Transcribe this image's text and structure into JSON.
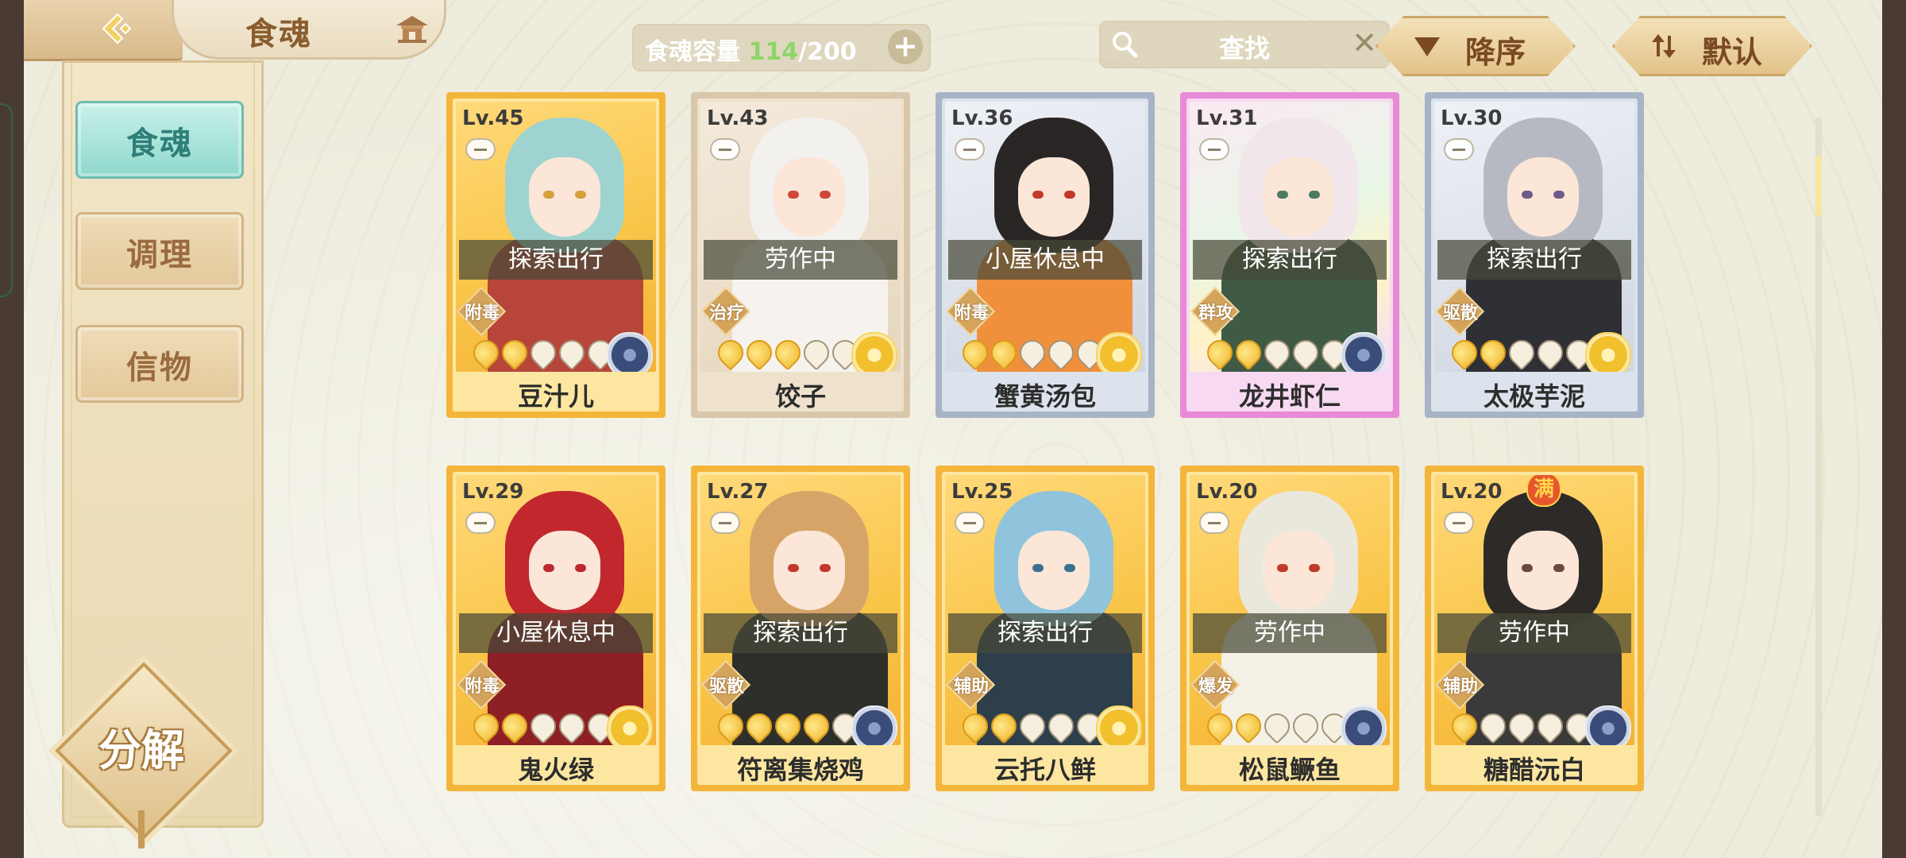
{
  "header": {
    "title": "食魂",
    "capacity_label": "食魂容量",
    "capacity_current": "114",
    "capacity_sep": "/",
    "capacity_max": "200",
    "capacity_plus": "+",
    "search_placeholder": "查找",
    "search_clear": "✕",
    "sort_order": "降序",
    "sort_mode": "默认"
  },
  "sidebar": {
    "items": [
      {
        "label": "食魂",
        "active": true
      },
      {
        "label": "调理",
        "active": false
      },
      {
        "label": "信物",
        "active": false
      }
    ],
    "decompose_label": "分解"
  },
  "scroll": {
    "position_fraction": 0.06
  },
  "cards": [
    {
      "level": "Lv.45",
      "status": "探索出行",
      "role": "附毒",
      "stars": 2,
      "emblem": "blue",
      "name": "豆汁儿",
      "art": "gold",
      "hair": "#9fd3d0",
      "outfit": "#b7453a",
      "eyes": "#d4a23b",
      "full": ""
    },
    {
      "level": "Lv.43",
      "status": "劳作中",
      "role": "治疗",
      "stars": 3,
      "emblem": "gold",
      "name": "饺子",
      "art": "beige",
      "hair": "#f3f1ee",
      "outfit": "#f6f3ef",
      "eyes": "#d0473a",
      "full": ""
    },
    {
      "level": "Lv.36",
      "status": "小屋休息中",
      "role": "附毒",
      "stars": 2,
      "emblem": "gold",
      "name": "蟹黄汤包",
      "art": "silver",
      "hair": "#2b2626",
      "outfit": "#f08f3c",
      "eyes": "#c0392b",
      "full": ""
    },
    {
      "level": "Lv.31",
      "status": "探索出行",
      "role": "群攻",
      "stars": 2,
      "emblem": "blue",
      "name": "龙井虾仁",
      "art": "rainbow",
      "hair": "#f1e6ea",
      "outfit": "#3f5a45",
      "eyes": "#4a7a64",
      "full": ""
    },
    {
      "level": "Lv.30",
      "status": "探索出行",
      "role": "驱散",
      "stars": 2,
      "emblem": "gold",
      "name": "太极芋泥",
      "art": "silver",
      "hair": "#b7b9c2",
      "outfit": "#2f2f36",
      "eyes": "#6b5a8a",
      "full": ""
    },
    {
      "level": "Lv.29",
      "status": "小屋休息中",
      "role": "附毒",
      "stars": 2,
      "emblem": "gold",
      "name": "鬼火绿",
      "art": "gold",
      "hair": "#c1272d",
      "outfit": "#8e1f24",
      "eyes": "#c1272d",
      "full": ""
    },
    {
      "level": "Lv.27",
      "status": "探索出行",
      "role": "驱散",
      "stars": 4,
      "emblem": "blue",
      "name": "符离集烧鸡",
      "art": "gold",
      "hair": "#d7a468",
      "outfit": "#2e2f2b",
      "eyes": "#c0392b",
      "full": ""
    },
    {
      "level": "Lv.25",
      "status": "探索出行",
      "role": "辅助",
      "stars": 2,
      "emblem": "gold",
      "name": "云托八鲜",
      "art": "gold",
      "hair": "#8fc4dc",
      "outfit": "#2d3f4a",
      "eyes": "#3b6f91",
      "full": ""
    },
    {
      "level": "Lv.20",
      "status": "劳作中",
      "role": "爆发",
      "stars": 2,
      "emblem": "blue",
      "name": "松鼠鳜鱼",
      "art": "gold",
      "hair": "#eae8dc",
      "outfit": "#f4f1e6",
      "eyes": "#c0392b",
      "full": ""
    },
    {
      "level": "Lv.20",
      "status": "劳作中",
      "role": "辅助",
      "stars": 1,
      "emblem": "blue",
      "name": "糖醋沅白",
      "art": "gold",
      "hair": "#2e2a28",
      "outfit": "#3a3a3a",
      "eyes": "#6a4a3a",
      "full": "满"
    }
  ]
}
